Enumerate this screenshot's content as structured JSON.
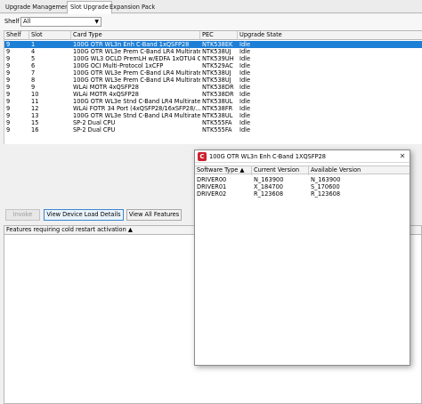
{
  "tabs": [
    {
      "label": "Upgrade Management",
      "active": false
    },
    {
      "label": "Slot Upgrade",
      "active": true
    },
    {
      "label": "Expansion Pack",
      "active": false
    }
  ],
  "shelf_filter": {
    "label": "Shelf",
    "value": "All"
  },
  "slot_table": {
    "columns": [
      "Shelf",
      "Slot",
      "Card Type",
      "PEC",
      "Upgrade State"
    ],
    "rows": [
      {
        "shelf": "9",
        "slot": "1",
        "card_type": "100G OTR WL3n Enh C-Band 1xQSFP28",
        "pec": "NTK538EK",
        "state": "Idle",
        "selected": true
      },
      {
        "shelf": "9",
        "slot": "4",
        "card_type": "100G OTR WL3e Prem C-Band LR4 Multirate",
        "pec": "NTK538UJ",
        "state": "Idle"
      },
      {
        "shelf": "9",
        "slot": "5",
        "card_type": "100G WL3 OCLD PremLH w/EDFA 1xOTU4 C-...",
        "pec": "NTK539UH",
        "state": "Idle"
      },
      {
        "shelf": "9",
        "slot": "6",
        "card_type": "100G OCI Multi-Protocol 1xCFP",
        "pec": "NTK529AC",
        "state": "Idle"
      },
      {
        "shelf": "9",
        "slot": "7",
        "card_type": "100G OTR WL3e Prem C-Band LR4 Multirate",
        "pec": "NTK538UJ",
        "state": "Idle"
      },
      {
        "shelf": "9",
        "slot": "8",
        "card_type": "100G OTR WL3e Prem C-Band LR4 Multirate",
        "pec": "NTK538UJ",
        "state": "Idle"
      },
      {
        "shelf": "9",
        "slot": "9",
        "card_type": "WLAi MOTR 4xQSFP28",
        "pec": "NTK538DR",
        "state": "Idle"
      },
      {
        "shelf": "9",
        "slot": "10",
        "card_type": "WLAi MOTR 4xQSFP28",
        "pec": "NTK538DR",
        "state": "Idle"
      },
      {
        "shelf": "9",
        "slot": "11",
        "card_type": "100G OTR WL3e Stnd C-Band LR4 Multirate",
        "pec": "NTK538UL",
        "state": "Idle"
      },
      {
        "shelf": "9",
        "slot": "12",
        "card_type": "WLAi FOTR 34 Port (4xQSFP28/16xSFP28/...",
        "pec": "NTK538FR",
        "state": "Idle"
      },
      {
        "shelf": "9",
        "slot": "13",
        "card_type": "100G OTR WL3e Stnd C-Band LR4 Multirate",
        "pec": "NTK538UL",
        "state": "Idle"
      },
      {
        "shelf": "9",
        "slot": "15",
        "card_type": "SP-2 Dual CPU",
        "pec": "NTK555FA",
        "state": "Idle"
      },
      {
        "shelf": "9",
        "slot": "16",
        "card_type": "SP-2 Dual CPU",
        "pec": "NTK555FA",
        "state": "Idle"
      }
    ]
  },
  "buttons": {
    "invoke": "Invoke",
    "view_device_load_details": "View Device Load Details",
    "view_all_features": "View All Features"
  },
  "features_panel": {
    "header": "Features requiring cold restart activation ▲"
  },
  "dialog": {
    "title": "100G OTR WL3n Enh C-Band 1XQSFP28",
    "close_symbol": "✕",
    "columns": [
      "Software Type ▲",
      "Current Version",
      "Available Version"
    ],
    "rows": [
      {
        "type": "DRIVER00",
        "current": "N_163900",
        "available": "N_163900"
      },
      {
        "type": "DRIVER01",
        "current": "X_184700",
        "available": "S_170600"
      },
      {
        "type": "DRIVER02",
        "current": "R_123608",
        "available": "R_123608"
      }
    ]
  },
  "icons": {
    "app_logo": "ciena-logo-icon",
    "dropdown": "chevron-down-icon",
    "close": "close-icon"
  },
  "colors": {
    "selection": "#1e7fd6",
    "logo_red": "#cc1f2f"
  }
}
